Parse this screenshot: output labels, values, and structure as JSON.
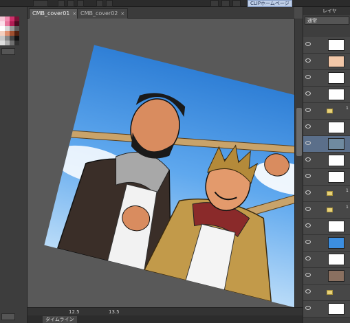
{
  "toolbar": {
    "clip_label": "CLIPホームページ"
  },
  "tabs": [
    {
      "label": "CMB_cover01"
    },
    {
      "label": "CMB_cover02"
    }
  ],
  "tab_close": "×",
  "status": {
    "zoom": "12.5",
    "angle": "13.5"
  },
  "timeline_label": "タイムライン",
  "layer_panel": {
    "header": "レイヤ",
    "blend_mode": "通常",
    "rows": [
      {
        "name": "",
        "type": "layer",
        "thumb": "#ffffff"
      },
      {
        "name": "",
        "type": "layer",
        "thumb": "#f2c7a8"
      },
      {
        "name": "",
        "type": "layer",
        "thumb": "#ffffff"
      },
      {
        "name": "",
        "type": "layer",
        "thumb": "#ffffff"
      },
      {
        "name": "1",
        "type": "folder",
        "thumb": ""
      },
      {
        "name": "",
        "type": "layer",
        "thumb": "#ffffff"
      },
      {
        "name": "",
        "type": "layer",
        "thumb": "#6f8aa0"
      },
      {
        "name": "",
        "type": "layer",
        "thumb": "#ffffff"
      },
      {
        "name": "",
        "type": "layer",
        "thumb": "#ffffff"
      },
      {
        "name": "1",
        "type": "folder",
        "thumb": ""
      },
      {
        "name": "1",
        "type": "folder",
        "thumb": ""
      },
      {
        "name": "",
        "type": "layer",
        "thumb": "#ffffff"
      },
      {
        "name": "",
        "type": "layer",
        "thumb": "#3c8ee0"
      },
      {
        "name": "",
        "type": "layer",
        "thumb": "#ffffff"
      },
      {
        "name": "",
        "type": "layer",
        "thumb": "#8a7060"
      },
      {
        "name": "",
        "type": "folder",
        "thumb": ""
      },
      {
        "name": "",
        "type": "layer",
        "thumb": "#ffffff"
      }
    ]
  },
  "colors": {
    "accent": "#5b6f8a",
    "sky_top": "#2f7fd6",
    "sky_bottom": "#b9dbf8"
  }
}
